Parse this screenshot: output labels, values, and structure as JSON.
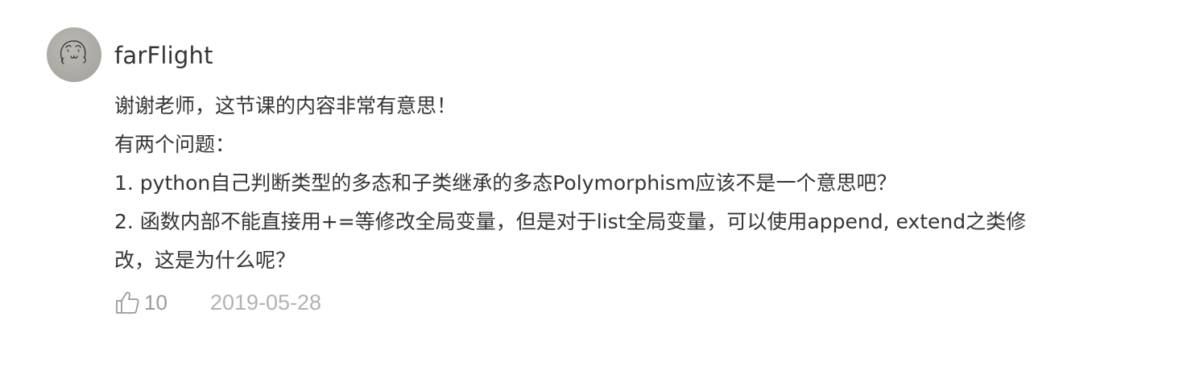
{
  "comment": {
    "author": "farFlight",
    "content_lines": [
      "谢谢老师，这节课的内容非常有意思！",
      "有两个问题：",
      "1. python自己判断类型的多态和子类继承的多态Polymorphism应该不是一个意思吧？",
      "2. 函数内部不能直接用+=等修改全局变量，但是对于list全局变量，可以使用append, extend之类修",
      "改，这是为什么呢？"
    ],
    "likes": "10",
    "date": "2019-05-28",
    "avatar_icon": "doodle-face-avatar",
    "like_icon": "thumbs-up-icon"
  }
}
